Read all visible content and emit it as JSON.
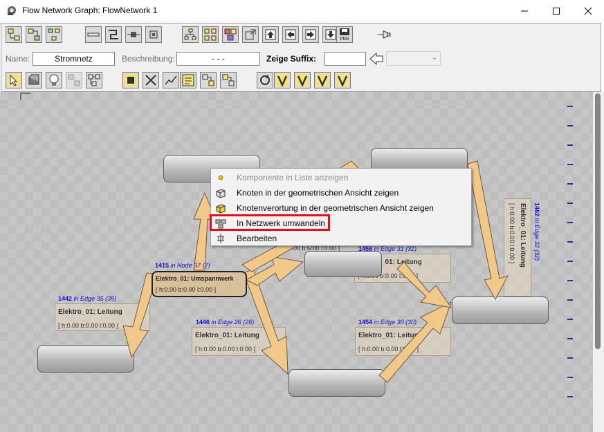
{
  "window": {
    "title": "Flow Network Graph: FlowNetwork 1",
    "minimize_icon": "minimize-icon",
    "maximize_icon": "maximize-icon",
    "close_icon": "close-icon"
  },
  "toolbar": {
    "name_label": "Name:",
    "name_value": "Stromnetz",
    "desc_label": "Beschreibung:",
    "desc_value": "- - -",
    "suffix_label": "Zeige Suffix:",
    "suffix_value": "",
    "suffix_combo_value": "",
    "png_label": "PNG"
  },
  "nodes": [
    {
      "id": "n-top-left",
      "label": "",
      "values": ""
    },
    {
      "id": "n-top-right",
      "label": "",
      "values": ""
    },
    {
      "id": "n-center",
      "label": "Elektro_01: Umspannwerk",
      "values": "[ h:0.00 b:0.00 l:0.00 ]"
    },
    {
      "id": "n-left",
      "label": "",
      "values": ""
    },
    {
      "id": "n-bottom",
      "label": "",
      "values": ""
    },
    {
      "id": "n-right",
      "label": "",
      "values": ""
    },
    {
      "id": "n-mid-right",
      "label": "",
      "values": ""
    }
  ],
  "node_title": {
    "id": "1415",
    "text": "in Node 37 (7)"
  },
  "edges": [
    {
      "id": "1442",
      "text": "in Edge 35 (35)",
      "label": "Elektro_01: Leitung",
      "values": "[ h:0.00 b:0.00 l:0.00 ]"
    },
    {
      "id": "1446",
      "text": "in Edge 26 (26)",
      "label": "Elektro_01: Leitung",
      "values": "[ h:0.00 b:0.00 l:0.00 ]"
    },
    {
      "id": "1454",
      "text": "in Edge 30 (30)",
      "label": "Elektro_01: Leitung",
      "values": "[ h:0.00 b:0.00 l:0.00 ]"
    },
    {
      "id": "1458",
      "text": "in Edge 31 (31)",
      "label": "Elektro_01: Leitung",
      "values": "[ h:0.00 b:0.00 l:0.00 ]"
    },
    {
      "id": "1462",
      "text": "in Edge 32 (32)",
      "label": "Elektro_01: Leitung",
      "values": "[ h:0.00 b:0.00 l:0.00 ]"
    }
  ],
  "partial_values": "[ h:0.00 b:0.00 l:0.00 ]",
  "edge_dots": "- - -",
  "context_menu": {
    "items": [
      {
        "label": "Komponente in Liste anzeigen",
        "icon": "yellow-dot-icon",
        "enabled": false
      },
      {
        "label": "Knoten in der geometrischen Ansicht zeigen",
        "icon": "cube-icon",
        "enabled": true
      },
      {
        "label": "Knotenverortung in der geometrischen Ansicht zeigen",
        "icon": "cube-place-icon",
        "enabled": true
      },
      {
        "label": "In Netzwerk umwandeln",
        "icon": "network-convert-icon",
        "enabled": true,
        "highlighted": true
      },
      {
        "label": "Bearbeiten",
        "icon": "edit-icon",
        "enabled": true
      }
    ]
  },
  "colors": {
    "arrow_fill": "#f2c88a",
    "arrow_stroke": "#6e5a3c",
    "highlight_box": "#e0101a",
    "edge_id_text": "#1010d0"
  }
}
